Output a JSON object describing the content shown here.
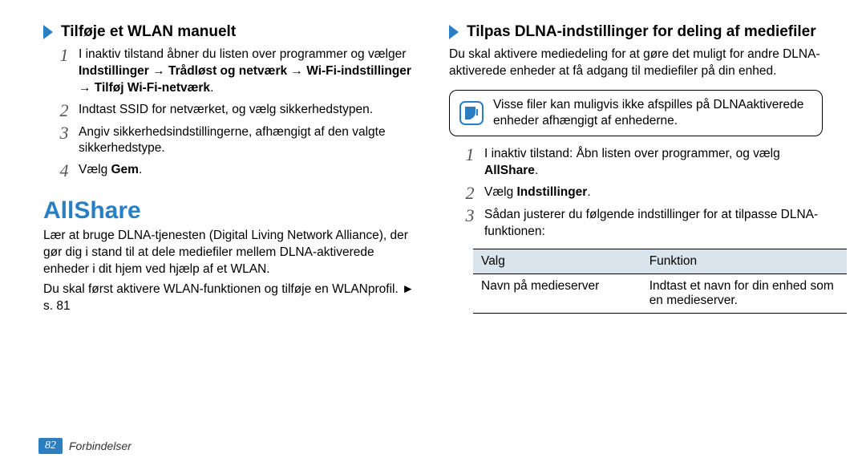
{
  "left": {
    "heading": "Tilføje et WLAN manuelt",
    "step1a": "I inaktiv tilstand åbner du listen over programmer og vælger ",
    "step1b": "Indstillinger → Trådløst og netværk → Wi-Fi-indstillinger → Tilføj Wi-Fi-netværk",
    "step1c": ".",
    "step2": "Indtast SSID for netværket, og vælg sikkerhedstypen.",
    "step3": "Angiv sikkerhedsindstillingerne, afhængigt af den valgte sikkerhedstype.",
    "step4a": "Vælg ",
    "step4b": "Gem",
    "step4c": ".",
    "allshare_title": "AllShare",
    "allshare_para1": "Lær at bruge DLNA-tjenesten (Digital Living Network Alliance), der gør dig i stand til at dele mediefiler mellem DLNA-aktiverede enheder i dit hjem ved hjælp af et WLAN.",
    "allshare_para2": "Du skal først aktivere WLAN-funktionen og tilføje en WLANprofil. ► s. 81"
  },
  "right": {
    "heading": "Tilpas DLNA-indstillinger for deling af mediefiler",
    "intro": "Du skal aktivere mediedeling for at gøre det muligt for andre DLNA-aktiverede enheder at få adgang til mediefiler på din enhed.",
    "note": "Visse filer kan muligvis ikke afspilles på DLNAaktiverede enheder afhængigt af enhederne.",
    "r_step1a": "I inaktiv tilstand: Åbn listen over programmer, og vælg ",
    "r_step1b": "AllShare",
    "r_step1c": ".",
    "r_step2a": "Vælg ",
    "r_step2b": "Indstillinger",
    "r_step2c": ".",
    "r_step3": "Sådan justerer du følgende indstillinger for at tilpasse DLNA-funktionen:",
    "table": {
      "h1": "Valg",
      "h2": "Funktion",
      "r1c1": "Navn på medieserver",
      "r1c2": "Indtast et navn for din enhed som en medieserver."
    }
  },
  "footer": {
    "page": "82",
    "section": "Forbindelser"
  }
}
